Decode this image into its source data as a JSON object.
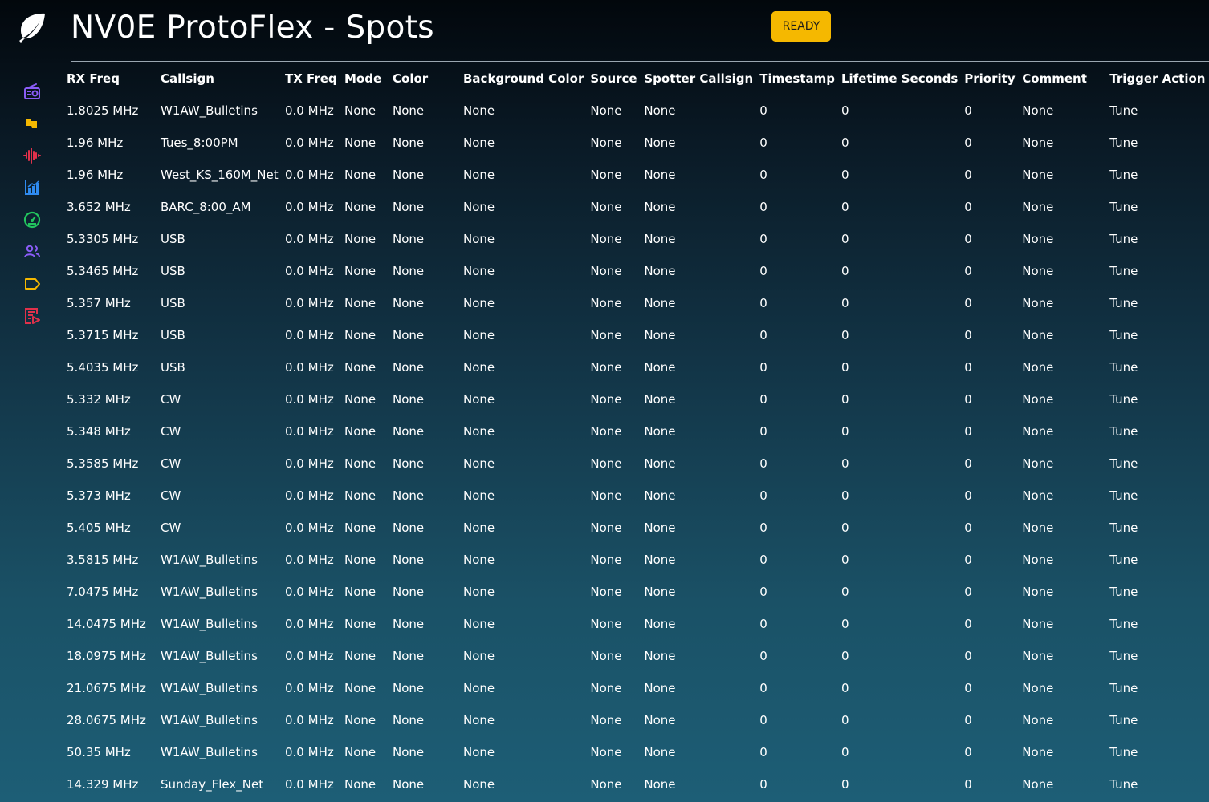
{
  "app": {
    "title": "NV0E ProtoFlex - Spots",
    "status_label": "READY",
    "accent_color": "#f5b800"
  },
  "sidebar": {
    "items": [
      {
        "icon": "radio-icon",
        "color": "#8a5cf6"
      },
      {
        "icon": "flag-icon",
        "color": "#f5b800"
      },
      {
        "icon": "waveform-icon",
        "color": "#e0314b"
      },
      {
        "icon": "bar-chart-icon",
        "color": "#2f8bf0"
      },
      {
        "icon": "gauge-icon",
        "color": "#22c55e"
      },
      {
        "icon": "users-icon",
        "color": "#8a5cf6"
      },
      {
        "icon": "tag-icon",
        "color": "#f5b800"
      },
      {
        "icon": "log-icon",
        "color": "#e0314b"
      }
    ]
  },
  "table": {
    "columns": [
      "RX Freq",
      "Callsign",
      "TX Freq",
      "Mode",
      "Color",
      "Background Color",
      "Source",
      "Spotter Callsign",
      "Timestamp",
      "Lifetime Seconds",
      "Priority",
      "Comment",
      "Trigger Action"
    ],
    "rows": [
      [
        "1.8025 MHz",
        "W1AW_Bulletins",
        "0.0 MHz",
        "None",
        "None",
        "None",
        "None",
        "None",
        "0",
        "0",
        "0",
        "None",
        "Tune"
      ],
      [
        "1.96 MHz",
        "Tues_8:00PM",
        "0.0 MHz",
        "None",
        "None",
        "None",
        "None",
        "None",
        "0",
        "0",
        "0",
        "None",
        "Tune"
      ],
      [
        "1.96 MHz",
        "West_KS_160M_Net",
        "0.0 MHz",
        "None",
        "None",
        "None",
        "None",
        "None",
        "0",
        "0",
        "0",
        "None",
        "Tune"
      ],
      [
        "3.652 MHz",
        "BARC_8:00_AM",
        "0.0 MHz",
        "None",
        "None",
        "None",
        "None",
        "None",
        "0",
        "0",
        "0",
        "None",
        "Tune"
      ],
      [
        "5.3305 MHz",
        "USB",
        "0.0 MHz",
        "None",
        "None",
        "None",
        "None",
        "None",
        "0",
        "0",
        "0",
        "None",
        "Tune"
      ],
      [
        "5.3465 MHz",
        "USB",
        "0.0 MHz",
        "None",
        "None",
        "None",
        "None",
        "None",
        "0",
        "0",
        "0",
        "None",
        "Tune"
      ],
      [
        "5.357 MHz",
        "USB",
        "0.0 MHz",
        "None",
        "None",
        "None",
        "None",
        "None",
        "0",
        "0",
        "0",
        "None",
        "Tune"
      ],
      [
        "5.3715 MHz",
        "USB",
        "0.0 MHz",
        "None",
        "None",
        "None",
        "None",
        "None",
        "0",
        "0",
        "0",
        "None",
        "Tune"
      ],
      [
        "5.4035 MHz",
        "USB",
        "0.0 MHz",
        "None",
        "None",
        "None",
        "None",
        "None",
        "0",
        "0",
        "0",
        "None",
        "Tune"
      ],
      [
        "5.332 MHz",
        "CW",
        "0.0 MHz",
        "None",
        "None",
        "None",
        "None",
        "None",
        "0",
        "0",
        "0",
        "None",
        "Tune"
      ],
      [
        "5.348 MHz",
        "CW",
        "0.0 MHz",
        "None",
        "None",
        "None",
        "None",
        "None",
        "0",
        "0",
        "0",
        "None",
        "Tune"
      ],
      [
        "5.3585 MHz",
        "CW",
        "0.0 MHz",
        "None",
        "None",
        "None",
        "None",
        "None",
        "0",
        "0",
        "0",
        "None",
        "Tune"
      ],
      [
        "5.373 MHz",
        "CW",
        "0.0 MHz",
        "None",
        "None",
        "None",
        "None",
        "None",
        "0",
        "0",
        "0",
        "None",
        "Tune"
      ],
      [
        "5.405 MHz",
        "CW",
        "0.0 MHz",
        "None",
        "None",
        "None",
        "None",
        "None",
        "0",
        "0",
        "0",
        "None",
        "Tune"
      ],
      [
        "3.5815 MHz",
        "W1AW_Bulletins",
        "0.0 MHz",
        "None",
        "None",
        "None",
        "None",
        "None",
        "0",
        "0",
        "0",
        "None",
        "Tune"
      ],
      [
        "7.0475 MHz",
        "W1AW_Bulletins",
        "0.0 MHz",
        "None",
        "None",
        "None",
        "None",
        "None",
        "0",
        "0",
        "0",
        "None",
        "Tune"
      ],
      [
        "14.0475 MHz",
        "W1AW_Bulletins",
        "0.0 MHz",
        "None",
        "None",
        "None",
        "None",
        "None",
        "0",
        "0",
        "0",
        "None",
        "Tune"
      ],
      [
        "18.0975 MHz",
        "W1AW_Bulletins",
        "0.0 MHz",
        "None",
        "None",
        "None",
        "None",
        "None",
        "0",
        "0",
        "0",
        "None",
        "Tune"
      ],
      [
        "21.0675 MHz",
        "W1AW_Bulletins",
        "0.0 MHz",
        "None",
        "None",
        "None",
        "None",
        "None",
        "0",
        "0",
        "0",
        "None",
        "Tune"
      ],
      [
        "28.0675 MHz",
        "W1AW_Bulletins",
        "0.0 MHz",
        "None",
        "None",
        "None",
        "None",
        "None",
        "0",
        "0",
        "0",
        "None",
        "Tune"
      ],
      [
        "50.35 MHz",
        "W1AW_Bulletins",
        "0.0 MHz",
        "None",
        "None",
        "None",
        "None",
        "None",
        "0",
        "0",
        "0",
        "None",
        "Tune"
      ],
      [
        "14.329 MHz",
        "Sunday_Flex_Net",
        "0.0 MHz",
        "None",
        "None",
        "None",
        "None",
        "None",
        "0",
        "0",
        "0",
        "None",
        "Tune"
      ]
    ]
  }
}
